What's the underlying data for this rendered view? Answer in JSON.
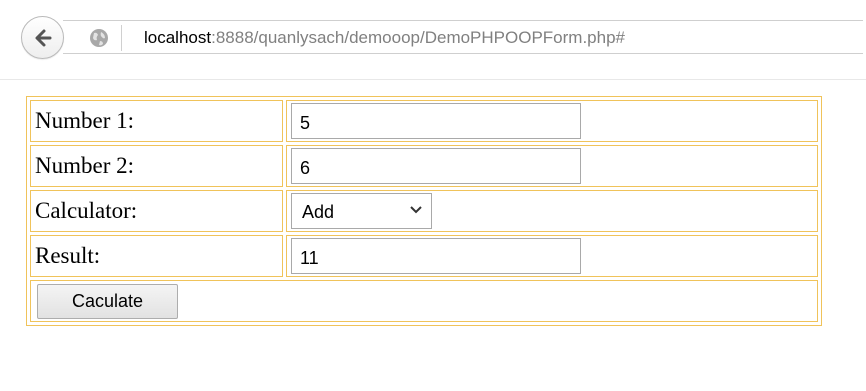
{
  "browser": {
    "url_host": "localhost",
    "url_path": ":8888/quanlysach/demooop/DemoPHPOOPForm.php#"
  },
  "form": {
    "number1_label": "Number 1:",
    "number1_value": "5",
    "number2_label": "Number 2:",
    "number2_value": "6",
    "calculator_label": "Calculator:",
    "calculator_selected": "Add",
    "result_label": "Result:",
    "result_value": "11",
    "calculate_button": "Caculate"
  },
  "colors": {
    "table_border": "#f0c35a"
  }
}
